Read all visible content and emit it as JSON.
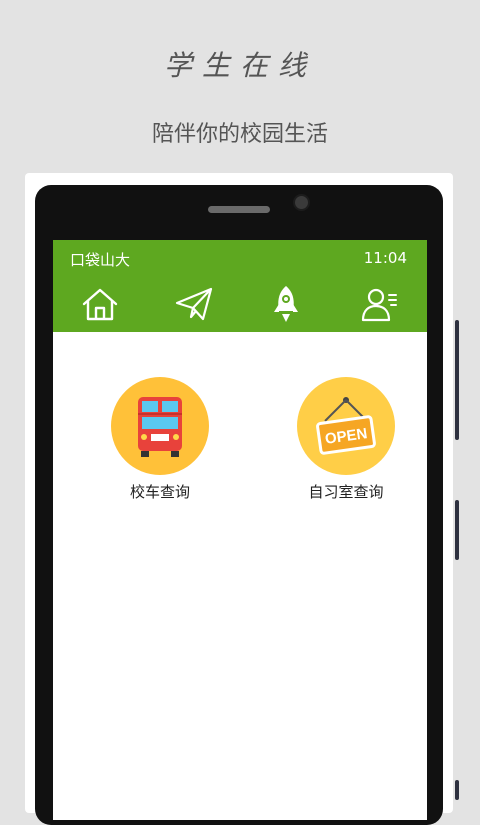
{
  "header": {
    "title": "学生在线",
    "subtitle": "陪伴你的校园生活"
  },
  "status_bar": {
    "carrier": "口袋山大",
    "time": "11:04"
  },
  "nav": {
    "items": [
      {
        "icon": "home-icon"
      },
      {
        "icon": "paper-plane-icon"
      },
      {
        "icon": "rocket-icon",
        "selected": true
      },
      {
        "icon": "profile-icon"
      }
    ]
  },
  "tiles": [
    {
      "label": "校车查询",
      "icon": "bus-icon",
      "circle_color": "#ffc139"
    },
    {
      "label": "自习室查询",
      "icon": "open-sign-icon",
      "circle_color": "#ffce47",
      "sign_text": "OPEN"
    }
  ],
  "colors": {
    "accent_green": "#5ea820",
    "background": "#e3e3e3"
  }
}
